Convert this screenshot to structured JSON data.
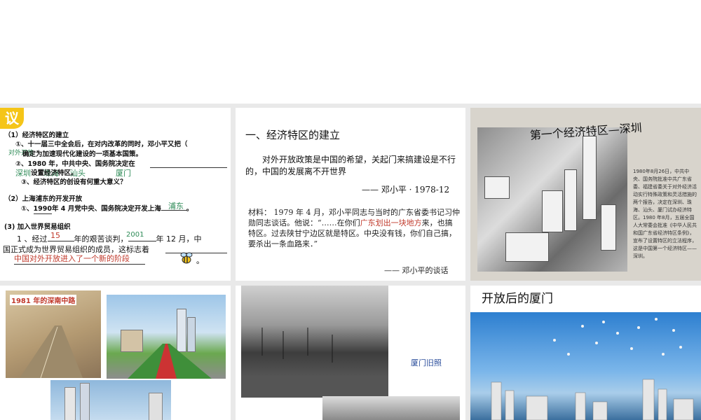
{
  "slide1": {
    "logo_text": "议",
    "sec1_title": "（1）经济特区的建立",
    "q1": "①、十一届三中全会后，在对内改革的同时，邓小平又把（",
    "q1b": "确定为加速现代化建设的一项基本国策。",
    "ans_open": "对外开放",
    "q2": "②、1980 年，中共中央、国务院决定在",
    "q2b": "设置经济特区。",
    "ans_cities": [
      "深圳",
      "珠海",
      "汕头",
      "厦门"
    ],
    "q3": "③、经济特区的创设有何重大意义？",
    "sec2_title": "（2）上海浦东的开发开放",
    "q4_pre": "①、",
    "q4_year": "1990",
    "q4": "年 4 月党中央、国务院决定开发上海",
    "ans_pudong": "浦东",
    "sec3_title": "(3) 加入世界贸易组织",
    "q5_pre": "1 、经过",
    "ans_years": "15",
    "q5_mid": "年的艰苦谈判，",
    "ans_year2": "2001",
    "q5_post": "年 12 月，中",
    "q5_line2": "国正式成为世界贸易组织的成员，这标志着",
    "ans_stage": "中国对外开放进入了一个新的阶段"
  },
  "slide2": {
    "title": "一、经济特区的建立",
    "quote": "对外开放政策是中国的希望，关起门来搞建设是不行的，中国的发展离不开世界",
    "quote_src": "—— 邓小平 · 1978-12",
    "material_a": "材料：  1979 年 4 月，邓小平同志与当时的广东省委书记习仲勋同志谈话。他说：“……在你们",
    "material_red": "广东划出一块地方",
    "material_b": "来，也搞特区。过去陕甘宁边区就是特区。中央没有钱，你们自己搞，要杀出一条血路来．”",
    "material_src": "—— 邓小平的谈话"
  },
  "slide3": {
    "title": "第一个经济特区—深圳",
    "note": "1980年8月26日，中共中央、国务院批准中共广东省委、福建省委关于对外经济活动实行特殊政策和灵活措施的两个报告，决定在深圳、珠海、汕头、厦门试办经济特区。1980 年8月，五届全国人大常委会批准《中华人民共和国广东省经济特区条例》，宣布了设置特区的立法程序，这是中国第一个经济特区——深圳。"
  },
  "slide4": {
    "caption": "1981 年的深南中路"
  },
  "slide5": {
    "caption": "厦门旧照"
  },
  "slide6": {
    "title": "开放后的厦门"
  }
}
